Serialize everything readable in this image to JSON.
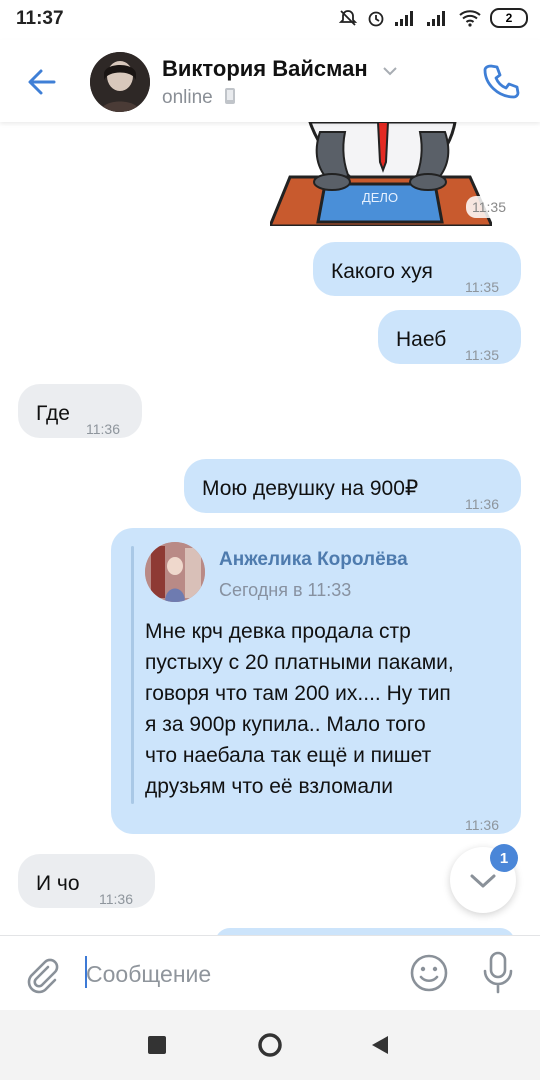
{
  "status_bar": {
    "time": "11:37",
    "battery": "2"
  },
  "header": {
    "contact_name": "Виктория Вайсман",
    "contact_status": "online"
  },
  "sticker": {
    "time": "11:35",
    "sign_text": "ДЕЛО"
  },
  "messages": [
    {
      "direction": "out",
      "text": "Какого хуя",
      "time": "11:35"
    },
    {
      "direction": "out",
      "text": "Наеб",
      "time": "11:35"
    },
    {
      "direction": "in",
      "text": "Где",
      "time": "11:36"
    },
    {
      "direction": "out",
      "text": "Мою девушку на 900₽",
      "time": "11:36"
    },
    {
      "direction": "in",
      "text": "И чо",
      "time": "11:36"
    }
  ],
  "forwarded": {
    "author": "Анжелика Королёва",
    "date": "Сегодня в 11:33",
    "text": "Мне крч девка продала стр\nпустыху с 20 платными паками,\nговоря что там 200 их.... Ну тип\nя за 900р купила.. Мало того\nчто наебала так ещё и пишет\nдрузьям что её взломали",
    "time": "11:36"
  },
  "scroll_down": {
    "unread_count": "1"
  },
  "composer": {
    "placeholder": "Сообщение"
  },
  "colors": {
    "accent": "#4a86d8",
    "out_bubble": "#cce4fb",
    "in_bubble": "#ebedf0",
    "forward_author": "#4e7bae"
  },
  "icons": {
    "back": "arrow-left-icon",
    "call": "phone-icon",
    "attach": "paperclip-icon",
    "emoji": "smiley-icon",
    "voice": "microphone-icon",
    "scroll": "chevron-down-icon"
  }
}
